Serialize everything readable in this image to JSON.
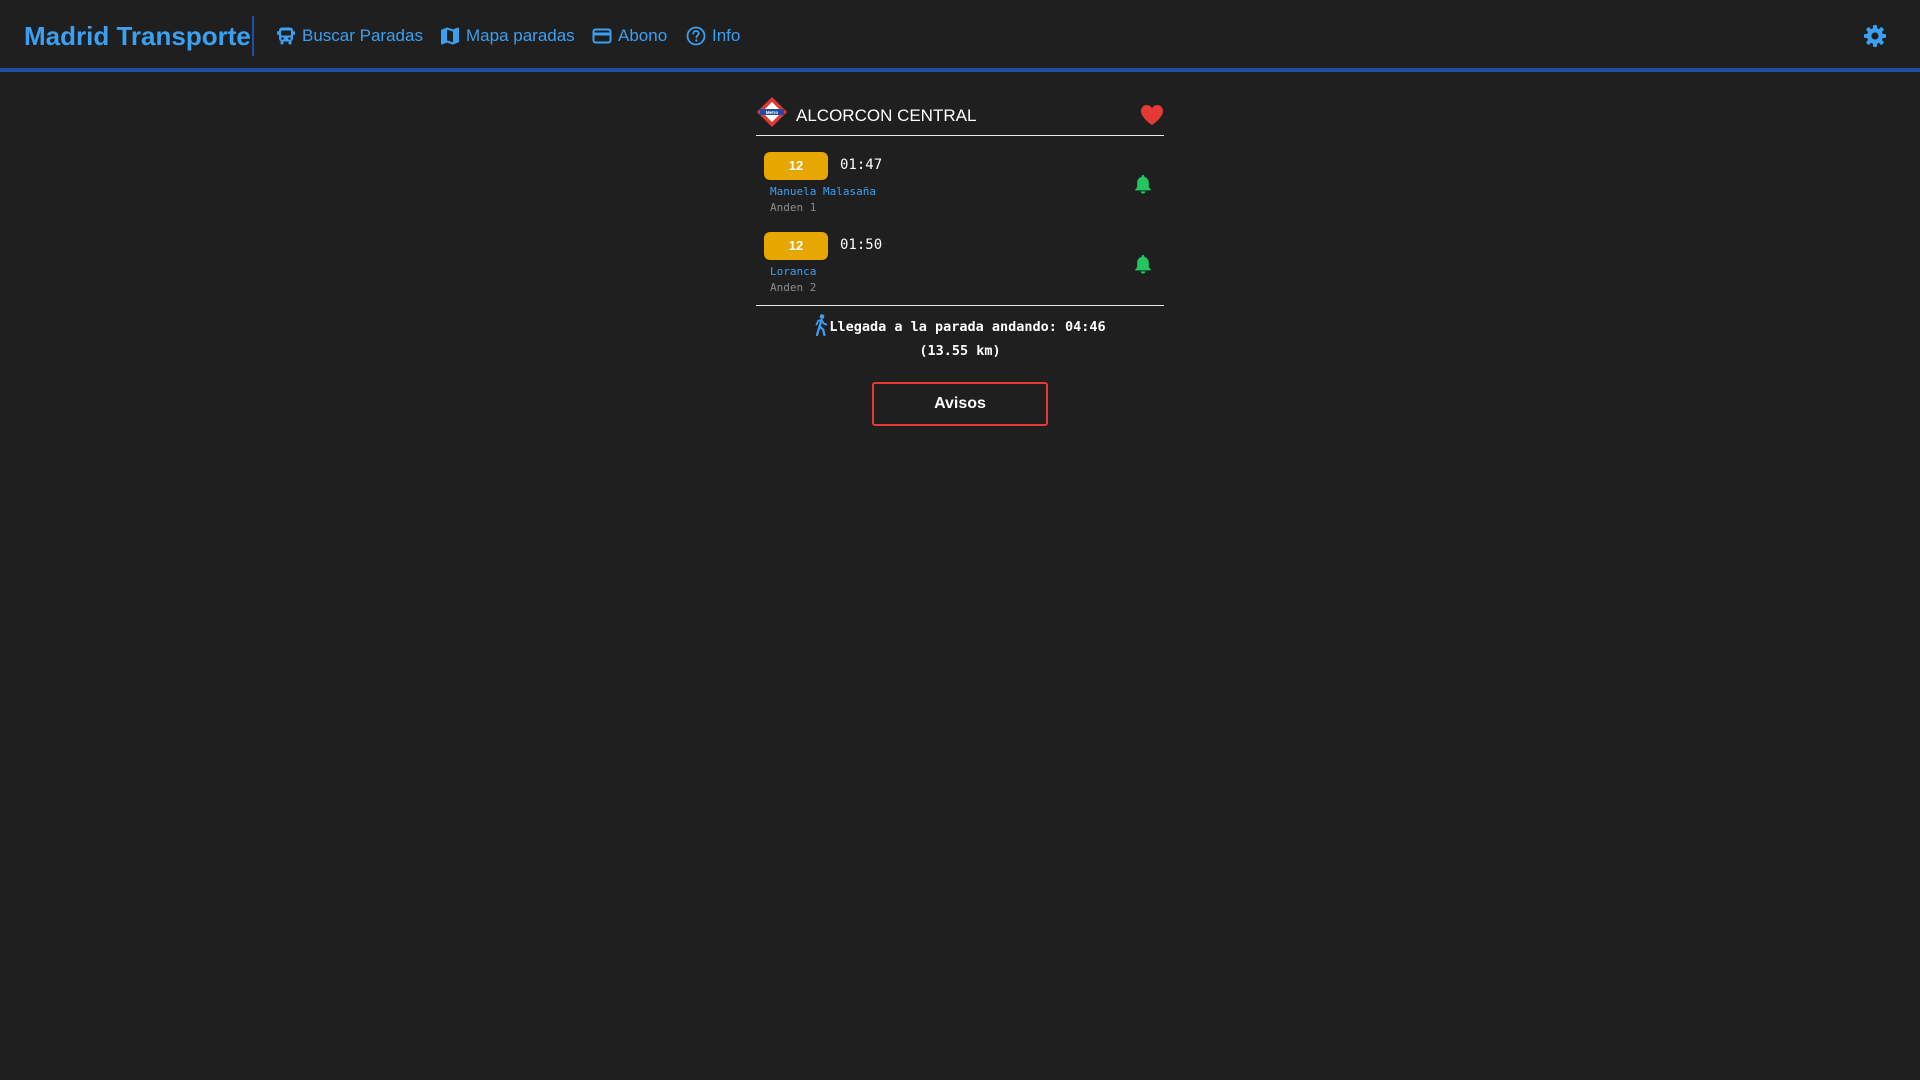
{
  "header": {
    "brand": "Madrid Transporte",
    "nav": [
      {
        "label": "Buscar Paradas",
        "icon": "bus-icon"
      },
      {
        "label": "Mapa paradas",
        "icon": "map-icon"
      },
      {
        "label": "Abono",
        "icon": "card-icon"
      },
      {
        "label": "Info",
        "icon": "help-circle-icon"
      }
    ],
    "settings_icon": "gear-icon"
  },
  "stop": {
    "name": "ALCORCON CENTRAL",
    "logo_text": "Metro",
    "logo_icon": "metro-logo-icon",
    "favorite_icon": "heart-icon",
    "arrivals": [
      {
        "line": "12",
        "time": "01:47",
        "destination": "Manuela Malasaña",
        "platform": "Anden 1",
        "alert_icon": "bell-icon"
      },
      {
        "line": "12",
        "time": "01:50",
        "destination": "Loranca",
        "platform": "Anden 2",
        "alert_icon": "bell-icon"
      }
    ],
    "walk_text": "Llegada a la parada andando: 04:46",
    "walk_distance": "(13.55 km)",
    "walk_icon": "walking-person-icon"
  },
  "avisos_label": "Avisos",
  "colors": {
    "background": "#1f1f1f",
    "accent": "#3ba0f2",
    "header_border": "#1f4fa3",
    "line_badge": "#e6a800",
    "bell": "#22c55e",
    "heart": "#e53935",
    "avisos_border": "#e53935"
  }
}
